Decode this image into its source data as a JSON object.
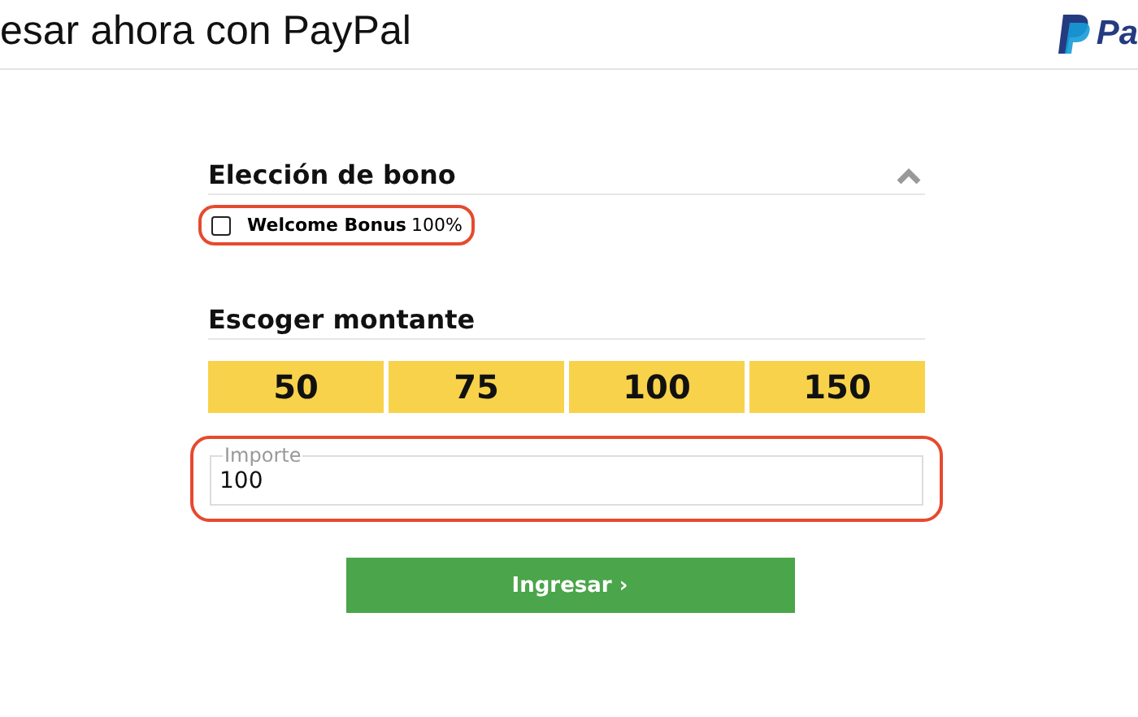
{
  "header": {
    "title": "esar ahora con PayPal",
    "logo_text": "Pa"
  },
  "bonus_section": {
    "title": "Elección de bono",
    "expanded": true,
    "options": [
      {
        "name": "Welcome Bonus",
        "value": "100%",
        "checked": false,
        "highlighted": true
      }
    ]
  },
  "amount_section": {
    "title": "Escoger montante",
    "amounts": [
      {
        "label": "50",
        "selected": false
      },
      {
        "label": "75",
        "selected": false
      },
      {
        "label": "100",
        "selected": false
      },
      {
        "label": "150",
        "selected": false
      }
    ],
    "field": {
      "label": "Importe",
      "value": "100",
      "highlighted": true
    }
  },
  "submit": {
    "label": "Ingresar ›"
  }
}
